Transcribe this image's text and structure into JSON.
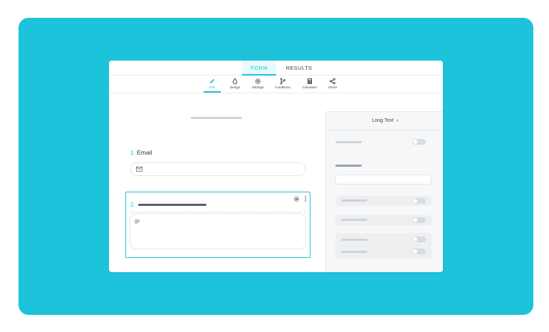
{
  "tabs": {
    "form": "FORM",
    "results": "RESULTS"
  },
  "toolbar": {
    "edit": "Edit",
    "design": "Design",
    "settings": "Settings",
    "conditions": "Conditions",
    "calculator": "Calculator",
    "share": "Share"
  },
  "form": {
    "q1_number": "1.",
    "q1_label": "Email",
    "q2_number": "2."
  },
  "panel": {
    "field_type": "Long Text"
  },
  "colors": {
    "accent": "#1dc3da",
    "background": "#1dc3da"
  }
}
